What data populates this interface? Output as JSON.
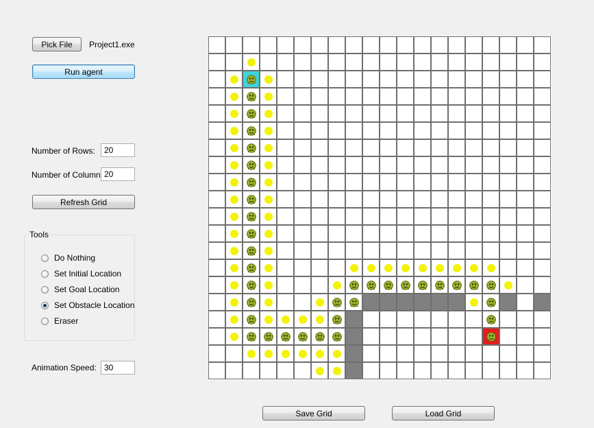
{
  "toolbar": {
    "pick_file_label": "Pick File",
    "file_name": "Project1.exe",
    "run_agent_label": "Run agent"
  },
  "grid_settings": {
    "rows_label": "Number of Rows:",
    "rows_value": "20",
    "cols_label": "Number of Columns:",
    "cols_value": "20",
    "refresh_label": "Refresh Grid"
  },
  "tools": {
    "title": "Tools",
    "options": [
      {
        "label": "Do Nothing",
        "checked": false
      },
      {
        "label": "Set Initial Location",
        "checked": false
      },
      {
        "label": "Set Goal Location",
        "checked": false
      },
      {
        "label": "Set Obstacle Location",
        "checked": true
      },
      {
        "label": "Eraser",
        "checked": false
      }
    ]
  },
  "animation": {
    "label": "Animation Speed:",
    "value": "30"
  },
  "bottom_buttons": {
    "save_label": "Save Grid",
    "load_label": "Load Grid"
  },
  "colors": {
    "obstacle": "#808080",
    "start": "#3fd3dc",
    "goal": "#e61d1d",
    "visited_dot": "#f2f20a",
    "agent_icon": "#9ab52a"
  },
  "grid": {
    "rows": 20,
    "cols": 20,
    "start": [
      2,
      2
    ],
    "goal": [
      17,
      16
    ],
    "obstacles": [
      [
        15,
        9
      ],
      [
        15,
        10
      ],
      [
        15,
        11
      ],
      [
        15,
        12
      ],
      [
        15,
        13
      ],
      [
        15,
        14
      ],
      [
        15,
        17
      ],
      [
        15,
        19
      ],
      [
        16,
        8
      ],
      [
        17,
        8
      ],
      [
        18,
        8
      ],
      [
        19,
        8
      ]
    ],
    "path": [
      [
        2,
        2
      ],
      [
        3,
        2
      ],
      [
        4,
        2
      ],
      [
        5,
        2
      ],
      [
        6,
        2
      ],
      [
        7,
        2
      ],
      [
        8,
        2
      ],
      [
        9,
        2
      ],
      [
        10,
        2
      ],
      [
        11,
        2
      ],
      [
        12,
        2
      ],
      [
        13,
        2
      ],
      [
        14,
        2
      ],
      [
        15,
        2
      ],
      [
        16,
        2
      ],
      [
        17,
        2
      ],
      [
        17,
        3
      ],
      [
        17,
        4
      ],
      [
        17,
        5
      ],
      [
        17,
        6
      ],
      [
        17,
        7
      ],
      [
        16,
        7
      ],
      [
        15,
        7
      ],
      [
        15,
        8
      ],
      [
        14,
        8
      ],
      [
        14,
        9
      ],
      [
        14,
        10
      ],
      [
        14,
        11
      ],
      [
        14,
        12
      ],
      [
        14,
        13
      ],
      [
        14,
        14
      ],
      [
        14,
        15
      ],
      [
        14,
        16
      ],
      [
        15,
        16
      ],
      [
        16,
        16
      ],
      [
        17,
        16
      ]
    ],
    "visited": [
      [
        1,
        2
      ],
      [
        2,
        1
      ],
      [
        2,
        3
      ],
      [
        3,
        1
      ],
      [
        3,
        3
      ],
      [
        4,
        1
      ],
      [
        4,
        3
      ],
      [
        5,
        1
      ],
      [
        5,
        3
      ],
      [
        6,
        1
      ],
      [
        6,
        3
      ],
      [
        7,
        1
      ],
      [
        7,
        3
      ],
      [
        8,
        1
      ],
      [
        8,
        3
      ],
      [
        9,
        1
      ],
      [
        9,
        3
      ],
      [
        10,
        1
      ],
      [
        10,
        3
      ],
      [
        11,
        1
      ],
      [
        11,
        3
      ],
      [
        12,
        1
      ],
      [
        12,
        3
      ],
      [
        13,
        1
      ],
      [
        13,
        3
      ],
      [
        14,
        1
      ],
      [
        14,
        3
      ],
      [
        15,
        1
      ],
      [
        15,
        3
      ],
      [
        16,
        1
      ],
      [
        16,
        3
      ],
      [
        16,
        4
      ],
      [
        16,
        5
      ],
      [
        16,
        6
      ],
      [
        17,
        1
      ],
      [
        18,
        2
      ],
      [
        18,
        3
      ],
      [
        18,
        4
      ],
      [
        18,
        5
      ],
      [
        18,
        6
      ],
      [
        18,
        7
      ],
      [
        19,
        6
      ],
      [
        19,
        7
      ],
      [
        15,
        6
      ],
      [
        14,
        7
      ],
      [
        13,
        8
      ],
      [
        13,
        9
      ],
      [
        13,
        10
      ],
      [
        13,
        11
      ],
      [
        13,
        12
      ],
      [
        13,
        13
      ],
      [
        13,
        14
      ],
      [
        13,
        15
      ],
      [
        13,
        16
      ],
      [
        14,
        17
      ],
      [
        15,
        15
      ]
    ]
  }
}
